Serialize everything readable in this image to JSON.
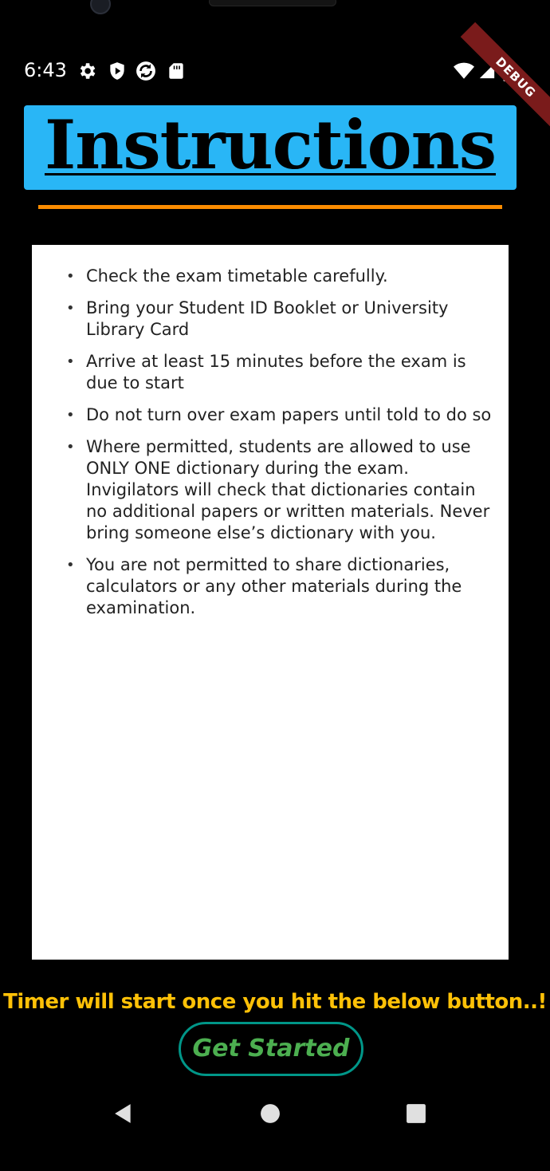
{
  "status_bar": {
    "time": "6:43",
    "icons": [
      "gear-icon",
      "play-protect-icon",
      "sync-icon",
      "sd-card-icon"
    ],
    "right_icons": [
      "wifi-icon",
      "signal-icon",
      "battery-icon"
    ],
    "debug_label": "DEBUG"
  },
  "header": {
    "title": "Instructions"
  },
  "instructions": {
    "items": [
      "Check the exam timetable carefully.",
      "Bring your Student ID Booklet or University Library Card",
      "Arrive at least 15 minutes before the exam is due to start",
      "Do not turn over exam papers until told to do so",
      "Where permitted, students are allowed to use ONLY ONE dictionary during the exam. Invigilators will check that dictionaries contain no additional papers or written materials. Never bring someone else’s dictionary with you.",
      "You are not permitted to share dictionaries, calculators or any other materials during the examination."
    ],
    "bullet": "•"
  },
  "footer": {
    "timer_note": "Timer will start once you hit the below button..!",
    "start_button": "Get Started"
  },
  "nav": {
    "icons": [
      "back-icon",
      "home-icon",
      "recents-icon"
    ]
  },
  "colors": {
    "title_bg": "#29b6f6",
    "divider": "#fb8c00",
    "timer_note": "#ffc107",
    "button_border": "#009688",
    "button_text": "#4caf50"
  }
}
